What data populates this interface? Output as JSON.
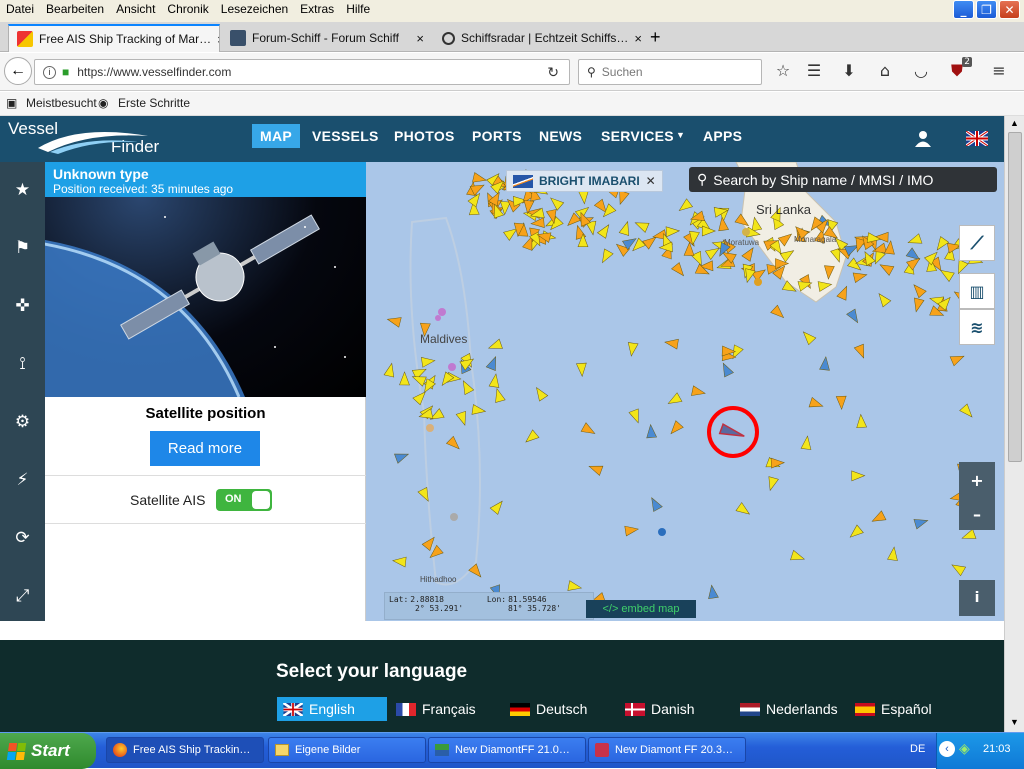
{
  "menubar": {
    "items": [
      "Datei",
      "Bearbeiten",
      "Ansicht",
      "Chronik",
      "Lesezeichen",
      "Extras",
      "Hilfe"
    ]
  },
  "tabs": [
    {
      "title": "Free AIS Ship Tracking of Mar…",
      "active": true
    },
    {
      "title": "Forum-Schiff - Forum Schiff",
      "active": false
    },
    {
      "title": "Schiffsradar | Echtzeit Schiffs…",
      "active": false
    }
  ],
  "tab_new": "+",
  "tab_close": "×",
  "navbar": {
    "url": "https://www.vesselfinder.com",
    "search_placeholder": "Suchen"
  },
  "bookmarks": {
    "items": [
      "Meistbesucht",
      "Erste Schritte"
    ],
    "ublock_badge": "2"
  },
  "site": {
    "logo_line1": "Vessel",
    "logo_line2": "Finder",
    "nav": [
      "MAP",
      "VESSELS",
      "PHOTOS",
      "PORTS",
      "NEWS",
      "SERVICES",
      "APPS"
    ],
    "active_nav": "MAP"
  },
  "panel": {
    "title": "Unknown type",
    "subtitle": "Position received: 35 minutes ago",
    "heading": "Satellite position",
    "read_more": "Read more",
    "sat_ais_label": "Satellite AIS",
    "toggle_state": "ON"
  },
  "map": {
    "selected_vessel": "BRIGHT IMABARI",
    "search_placeholder": "Search by Ship name / MMSI / IMO",
    "labels": {
      "sri_lanka": "Sri Lanka",
      "maldives": "Maldives",
      "colombo": "Moratuwa",
      "monaragala": "Monaragala",
      "hithadhoo": "Hithadhoo"
    },
    "coords": {
      "lat_label": "Lat:",
      "lat": "2.88818",
      "lon_label": "Lon:",
      "lon": "81.59546",
      "lat_dms": "2° 53.291'",
      "lon_dms": "81° 35.728'"
    },
    "embed_label": "</> embed map",
    "zoom_in": "+",
    "zoom_out": "–",
    "info": "i"
  },
  "footer": {
    "title": "Select your language",
    "languages": [
      "English",
      "Français",
      "Deutsch",
      "Danish",
      "Nederlands",
      "Español"
    ]
  },
  "taskbar": {
    "start": "Start",
    "tasks": [
      "Free AIS Ship Trackin…",
      "Eigene Bilder",
      "New DiamontFF 21.0…",
      "New Diamont FF 20.3…"
    ],
    "lang": "DE",
    "clock": "21:03"
  },
  "colors": {
    "site_header": "#1a4f6e",
    "accent_blue": "#1ea0e6",
    "toggle_green": "#3fb53f",
    "map_water": "#aac6e8",
    "highlight_circle": "#ff0000"
  }
}
